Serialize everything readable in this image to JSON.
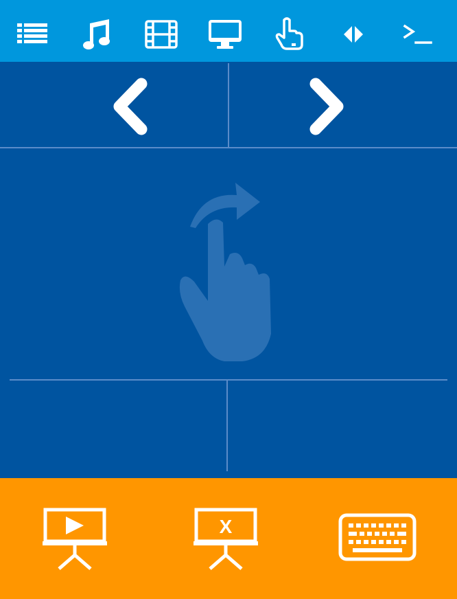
{
  "colors": {
    "topbar": "#0097dd",
    "touchpad": "#0054a0",
    "divider": "#5b8cc9",
    "bottombar": "#ff9600",
    "icon": "#ffffff",
    "gesture_hint": "#2a70b4"
  },
  "topbar": {
    "icons": [
      "list-icon",
      "music-icon",
      "film-icon",
      "monitor-icon",
      "touch-hand-icon",
      "left-right-arrows-icon",
      "terminal-icon"
    ]
  },
  "touchpad": {
    "nav_icons": [
      "chevron-left-icon",
      "chevron-right-icon"
    ],
    "gesture_hint_icon": "swipe-hand-icon"
  },
  "bottombar": {
    "icons": [
      "presentation-start-icon",
      "presentation-close-icon",
      "keyboard-icon"
    ],
    "close_glyph": "X"
  }
}
